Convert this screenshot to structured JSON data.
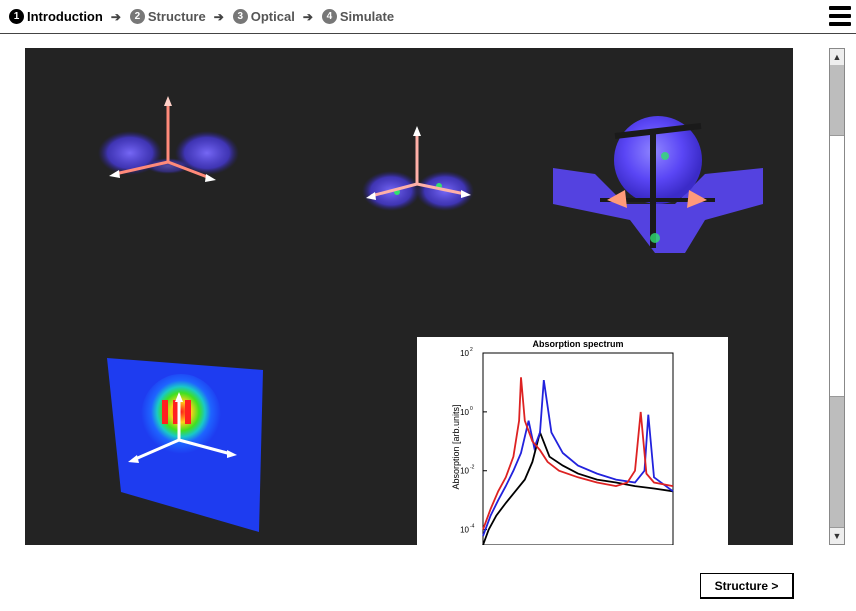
{
  "steps": [
    {
      "num": "1",
      "label": "Introduction",
      "active": true
    },
    {
      "num": "2",
      "label": "Structure"
    },
    {
      "num": "3",
      "label": "Optical"
    },
    {
      "num": "4",
      "label": "Simulate"
    }
  ],
  "arrow_glyph": "➔",
  "menu_icon": "hamburger-icon",
  "spectrum": {
    "title": "Absorption spectrum",
    "ylabel": "Absorption [arb.units]",
    "yticks": [
      "10",
      "10",
      "10",
      "10"
    ],
    "ytick_exp": [
      "2",
      "0",
      "-2",
      "-4"
    ]
  },
  "chart_data": {
    "type": "line",
    "title": "Absorption spectrum",
    "ylabel": "Absorption [arb.units]",
    "yscale": "log",
    "ylim": [
      3e-05,
      100
    ],
    "yticks": [
      100,
      1,
      0.01,
      0.0001
    ],
    "xlim": [
      0,
      1
    ],
    "series": [
      {
        "color": "#000000",
        "x": [
          0,
          0.03,
          0.07,
          0.12,
          0.17,
          0.22,
          0.26,
          0.3,
          0.35,
          0.42,
          0.5,
          0.6,
          0.7,
          0.8,
          0.9,
          1.0
        ],
        "y": [
          3e-05,
          0.0001,
          0.0003,
          0.0008,
          0.002,
          0.005,
          0.02,
          0.2,
          0.03,
          0.015,
          0.008,
          0.005,
          0.004,
          0.003,
          0.0025,
          0.002
        ]
      },
      {
        "color": "#2222dd",
        "x": [
          0,
          0.04,
          0.08,
          0.12,
          0.16,
          0.2,
          0.24,
          0.27,
          0.3,
          0.32,
          0.36,
          0.42,
          0.5,
          0.6,
          0.7,
          0.8,
          0.85,
          0.87,
          0.9,
          1.0
        ],
        "y": [
          6e-05,
          0.0003,
          0.001,
          0.003,
          0.01,
          0.04,
          0.5,
          0.06,
          0.2,
          12,
          0.2,
          0.04,
          0.015,
          0.008,
          0.005,
          0.004,
          0.01,
          0.8,
          0.006,
          0.002
        ]
      },
      {
        "color": "#dd2222",
        "x": [
          0,
          0.04,
          0.08,
          0.12,
          0.16,
          0.19,
          0.2,
          0.22,
          0.26,
          0.3,
          0.34,
          0.4,
          0.5,
          0.6,
          0.7,
          0.76,
          0.8,
          0.83,
          0.86,
          0.9,
          1.0
        ],
        "y": [
          0.0001,
          0.0005,
          0.002,
          0.006,
          0.03,
          0.5,
          15,
          0.5,
          0.1,
          0.05,
          0.02,
          0.01,
          0.006,
          0.004,
          0.003,
          0.004,
          0.01,
          1.0,
          0.008,
          0.004,
          0.003
        ]
      }
    ]
  },
  "next_button": "Structure >"
}
